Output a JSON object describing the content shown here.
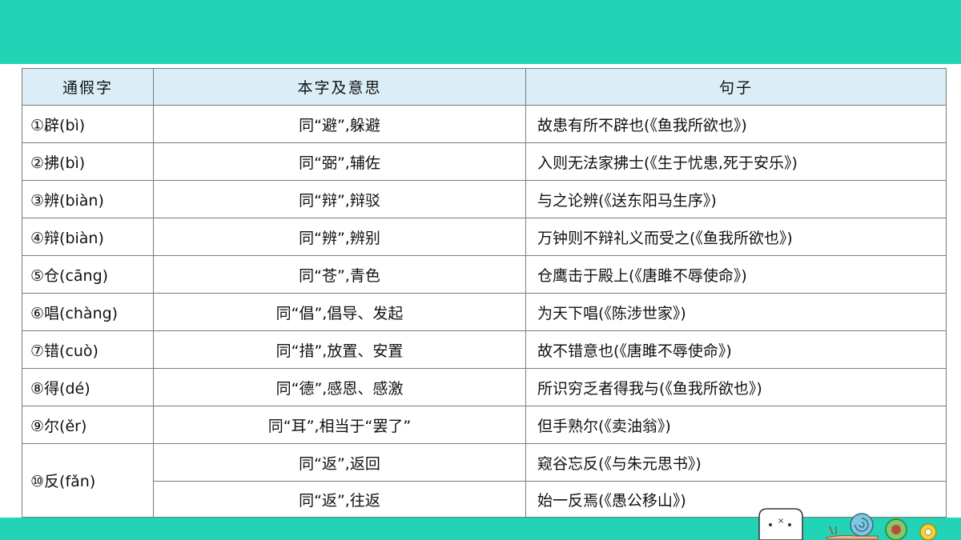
{
  "table": {
    "headers": [
      "通假字",
      "本字及意思",
      "句子"
    ],
    "rows": [
      {
        "jia": "①辟(bì)",
        "ben": "同“避”,躲避",
        "ju": "故患有所不辟也(《鱼我所欲也》)"
      },
      {
        "jia": "②拂(bì)",
        "ben": "同“弼”,辅佐",
        "ju": "入则无法家拂士(《生于忧患,死于安乐》)"
      },
      {
        "jia": "③辨(biàn)",
        "ben": "同“辩”,辩驳",
        "ju": "与之论辨(《送东阳马生序》)"
      },
      {
        "jia": "④辩(biàn)",
        "ben": "同“辨”,辨别",
        "ju": "万钟则不辩礼义而受之(《鱼我所欲也》)"
      },
      {
        "jia": "⑤仓(cāng)",
        "ben": "同“苍”,青色",
        "ju": "仓鹰击于殿上(《唐雎不辱使命》)"
      },
      {
        "jia": "⑥唱(chàng)",
        "ben": "同“倡”,倡导、发起",
        "ju": "为天下唱(《陈涉世家》)"
      },
      {
        "jia": "⑦错(cuò)",
        "ben": "同“措”,放置、安置",
        "ju": "故不错意也(《唐雎不辱使命》)"
      },
      {
        "jia": "⑧得(dé)",
        "ben": "同“德”,感恩、感激",
        "ju": "所识穷乏者得我与(《鱼我所欲也》)"
      },
      {
        "jia": "⑨尔(ěr)",
        "ben": "同“耳”,相当于“罢了”",
        "ju": "但手熟尔(《卖油翁》)"
      }
    ],
    "merged": {
      "jia": "⑩反(fǎn)",
      "rows": [
        {
          "ben": "同“返”,返回",
          "ju": "窥谷忘反(《与朱元思书》)"
        },
        {
          "ben": "同“返”,往返",
          "ju": "始一反焉(《愚公移山》)"
        }
      ]
    }
  },
  "colors": {
    "band": "#22d3b5",
    "header_bg": "#dbeef8",
    "border": "#7a7a7a"
  },
  "decoration_icons": [
    "cartoon-creature-icon",
    "snail-icon",
    "flower-icon",
    "flower-icon"
  ]
}
